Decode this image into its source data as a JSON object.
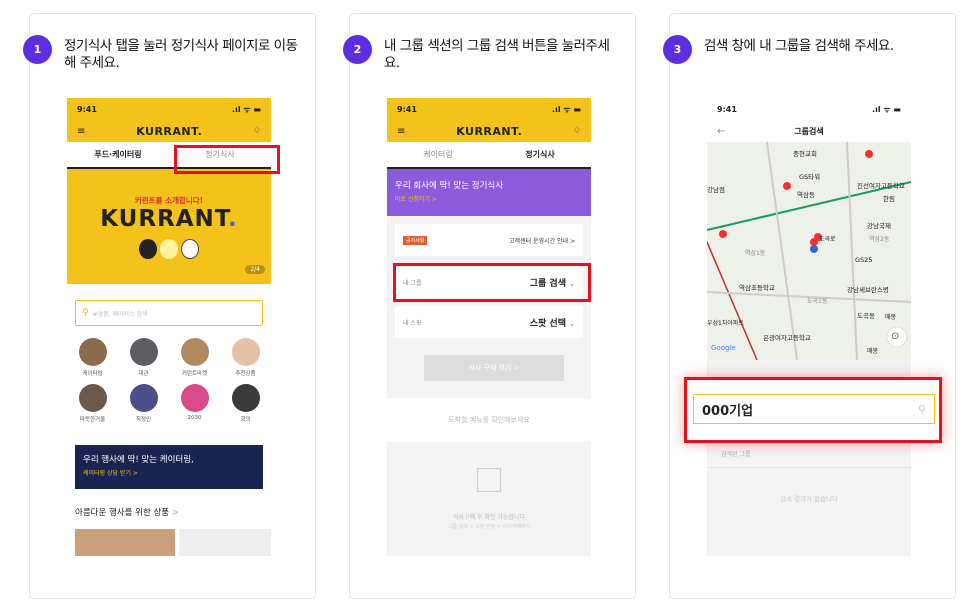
{
  "steps": [
    {
      "num": "1",
      "text": "정기식사 탭을 눌러 정기식사 페이지로 이동해 주세요."
    },
    {
      "num": "2",
      "text": "내 그룹 섹션의 그룹 검색 버튼을 눌러주세요."
    },
    {
      "num": "3",
      "text": "검색 창에 내 그룹을 검색해 주세요."
    }
  ],
  "status": {
    "time": "9:41",
    "icons": ".ıl ᯤ ▬"
  },
  "p1": {
    "logo": "KURRANT.",
    "tabs": [
      "푸드·케이터링",
      "정기식사"
    ],
    "banner_sub": "커런트를 소개합니다!",
    "banner_title": "KURRANT",
    "banner_count": "2/4",
    "search_placeholder": "#상품, 메이커스 검색",
    "cats": [
      "케이터링",
      "대관",
      "커런트마켓",
      "추천상품",
      "따뜻한거울",
      "직장인",
      "2030",
      "회의"
    ],
    "promo_title": "우리 행사에 딱! 맞는 케이터링,",
    "promo_sub": "케이터링 상담 받기 >",
    "section": "아름다운 행사를 위한 상품",
    "section_arrow": ">"
  },
  "p2": {
    "logo": "KURRANT.",
    "tabs": [
      "케이터링",
      "정기식사"
    ],
    "banner_title": "우리 회사에 딱! 맞는 정기식사",
    "banner_sub": "바로 신청하기 >",
    "notice_badge": "공지사항",
    "notice_text": "고객센터 운영시간 안내",
    "group_label": "내 그룹",
    "group_btn": "그룹 검색",
    "spot_label": "내 스팟",
    "spot_btn": "스팟 선택",
    "order_btn": "식사 구매 하기 >",
    "menu_text": "도착할 메뉴를 확인해보세요",
    "empty1": "식사구매 후 확인 가능합니다",
    "empty2": "그룹 검색 > 스팟 선택 > 식사구매하기",
    "chevron": "⌄",
    "arrow": ">"
  },
  "p3": {
    "title": "그룹검색",
    "back": "←",
    "map_labels": [
      "중현교회",
      "GS타워",
      "역삼동",
      "강남점",
      "진선여자고등학교",
      "한림",
      "강남국제",
      "역삼1동",
      "역삼2동",
      "GS25",
      "역삼초등학교",
      "도곡1동",
      "강남세브란스병",
      "도곡동",
      "매봉",
      "은광여자고등학교",
      "우성1차아파트",
      "Google",
      "매봉",
      "도곡로"
    ],
    "search_value": "000기업",
    "result_label": "검색된 그룹",
    "no_result": "검색 결과가 없습니다"
  },
  "colors": {
    "accent": "#5b2fe0",
    "brand": "#f3c21b",
    "highlight": "#e0141e",
    "map_road": "#1a9e5a"
  }
}
